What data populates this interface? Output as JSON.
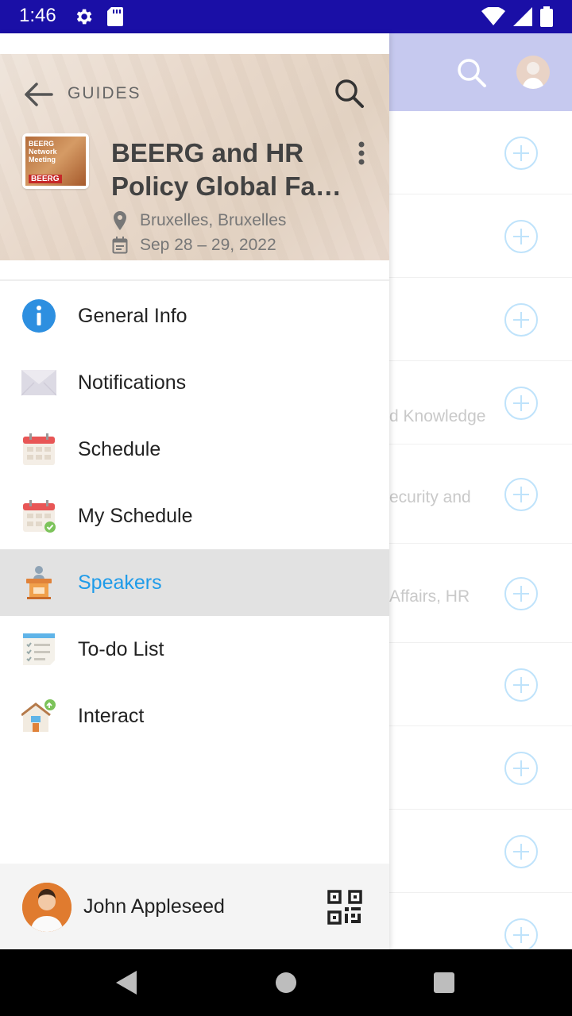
{
  "status_bar": {
    "time": "1:46"
  },
  "header": {
    "section_label": "GUIDES"
  },
  "event": {
    "title_line1": "BEERG and HR",
    "title_line2": "Policy Global Fa…",
    "location": "Bruxelles, Bruxelles",
    "dates": "Sep 28 – 29, 2022",
    "logo_lines": [
      "BEERG",
      "Network",
      "Meeting"
    ],
    "logo_brand": "BEERG"
  },
  "menu": {
    "items": [
      {
        "label": "General Info",
        "icon": "info-icon"
      },
      {
        "label": "Notifications",
        "icon": "envelope-icon"
      },
      {
        "label": "Schedule",
        "icon": "calendar-icon"
      },
      {
        "label": "My Schedule",
        "icon": "calendar-check-icon"
      },
      {
        "label": "Speakers",
        "icon": "podium-icon",
        "active": true
      },
      {
        "label": "To-do List",
        "icon": "checklist-icon"
      },
      {
        "label": "Interact",
        "icon": "interact-icon"
      }
    ]
  },
  "user": {
    "name": "John Appleseed"
  },
  "background_list": {
    "snippets": [
      "d Knowledge",
      "ecurity and",
      "Affairs, HR"
    ]
  },
  "colors": {
    "status_bar": "#1a0fa6",
    "toolbar": "#c6c9ef",
    "active_item_text": "#1e9be9",
    "active_item_bg": "#e2e2e2",
    "plus_icon": "#bfe3fb"
  }
}
